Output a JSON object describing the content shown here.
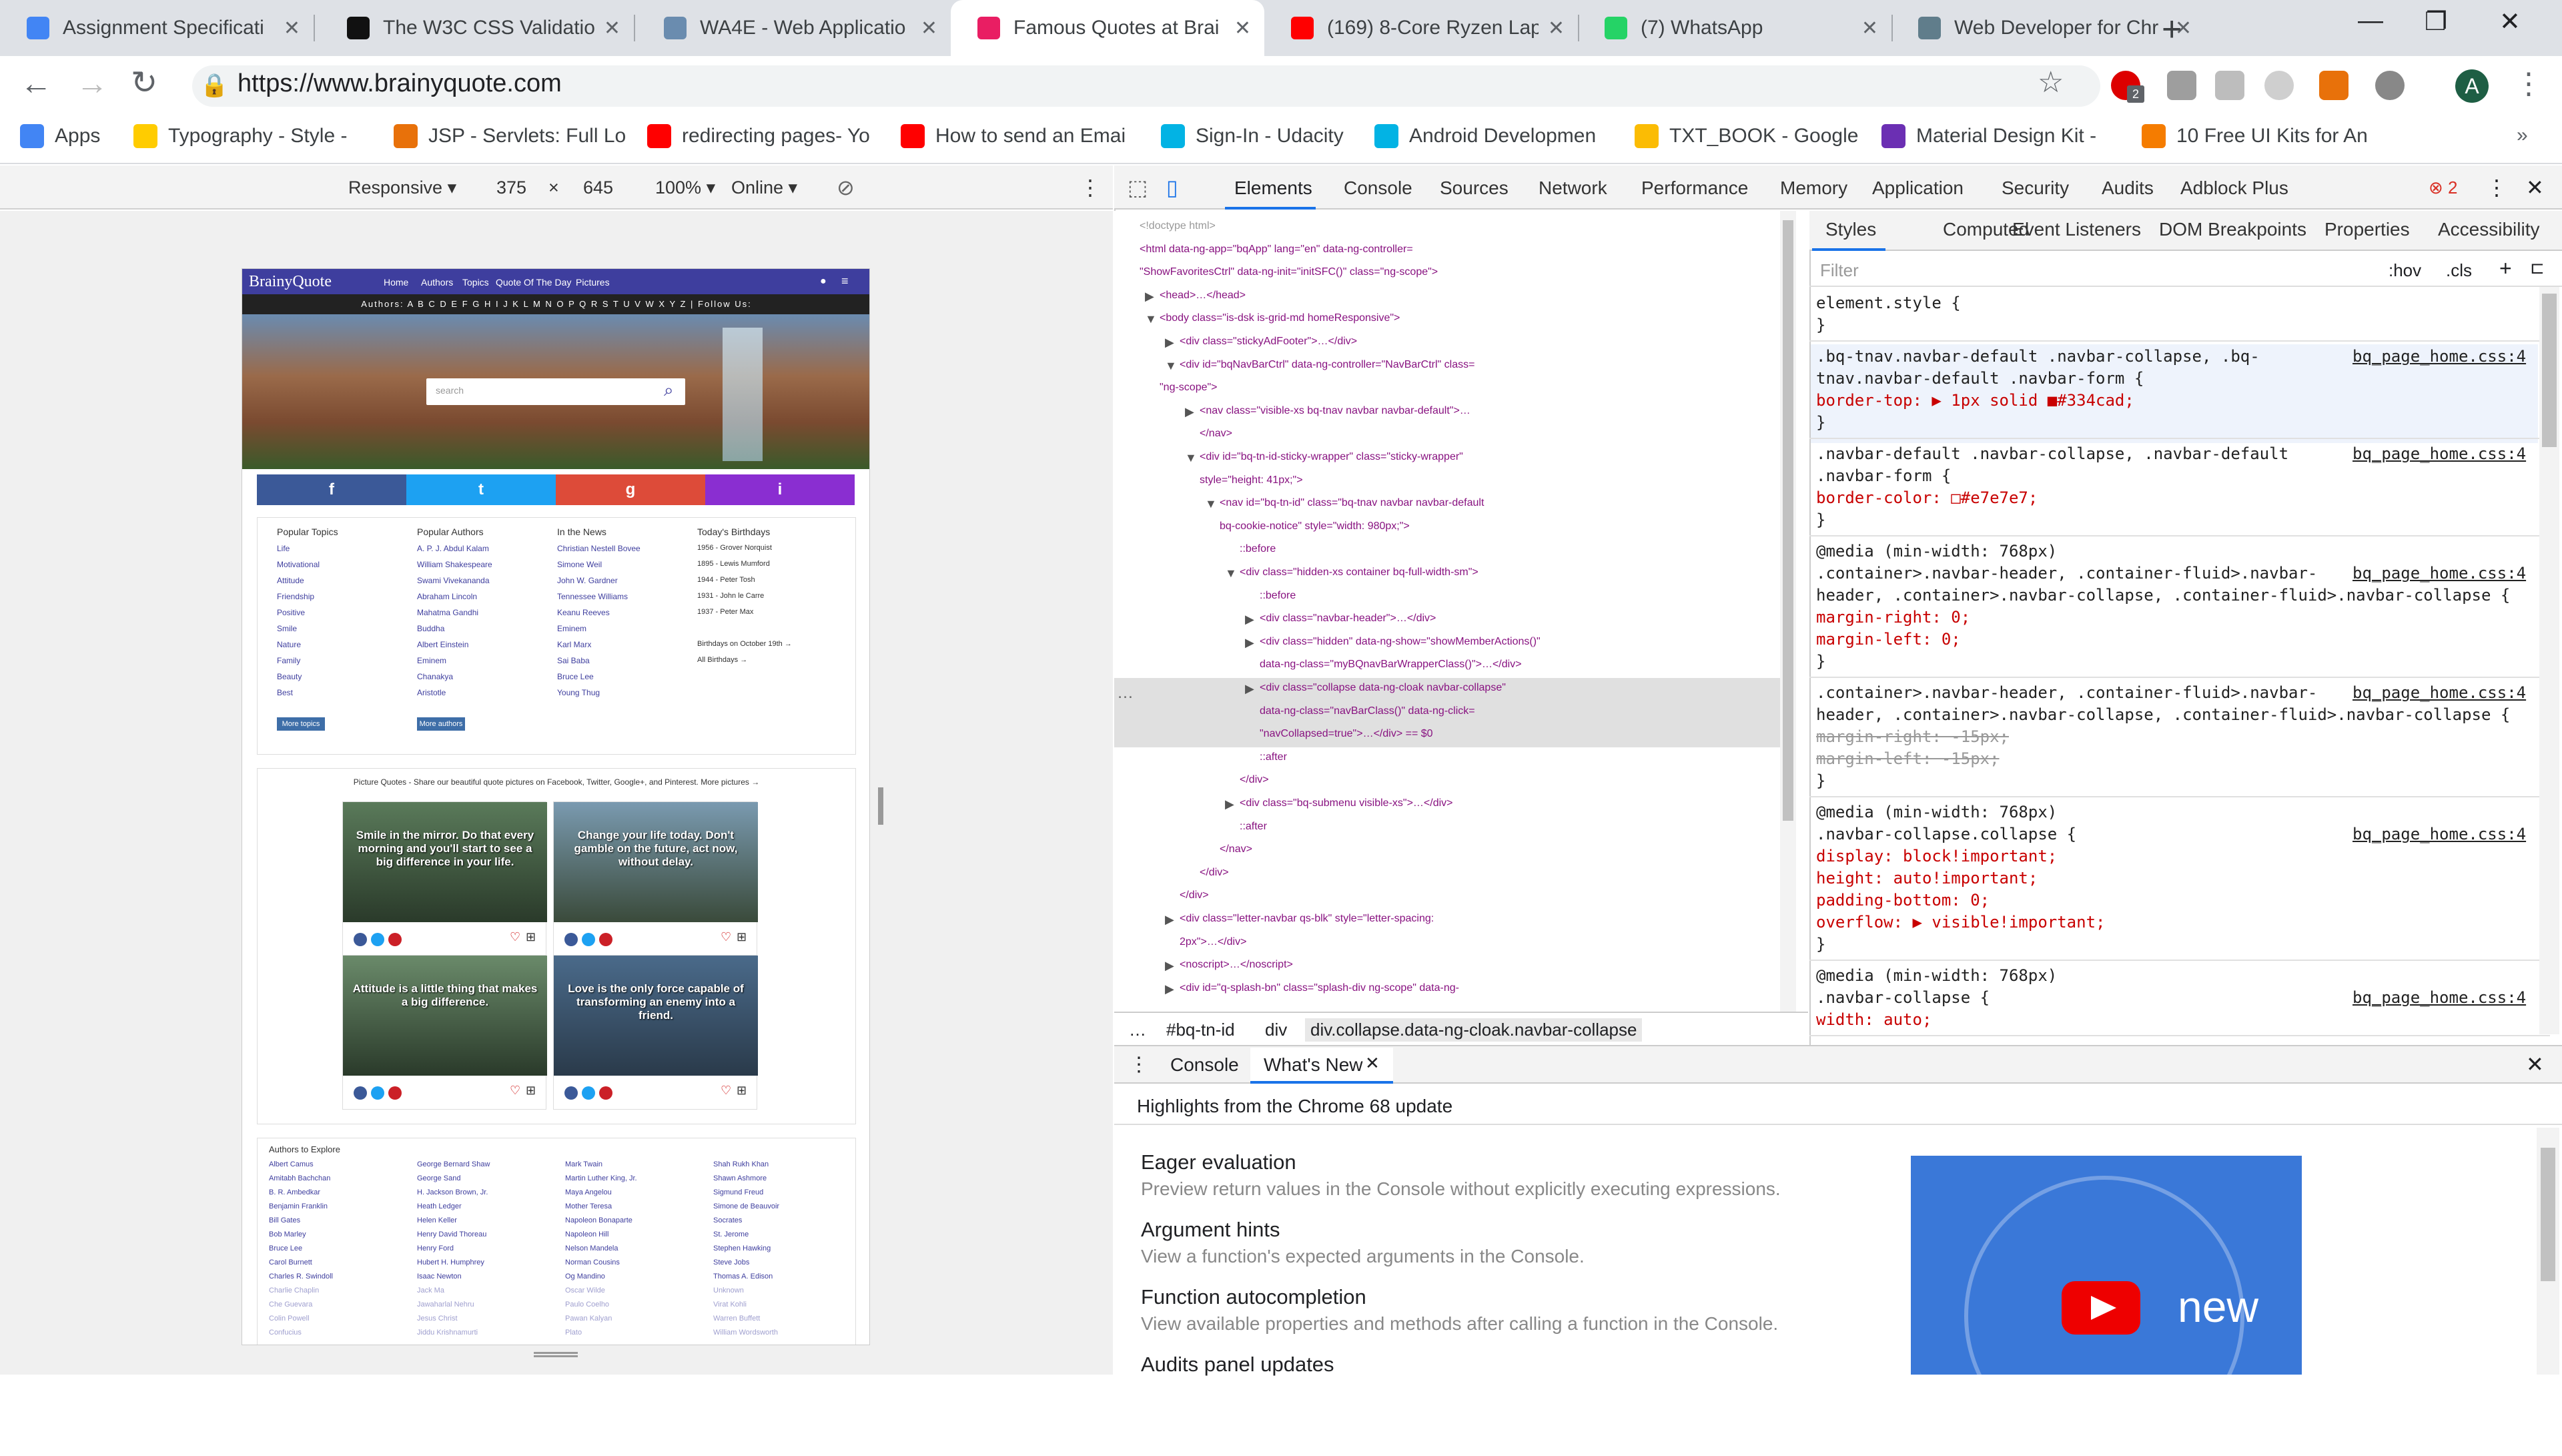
{
  "browser": {
    "tabs": [
      {
        "title": "Assignment Specificati",
        "icon_color": "#4285f4"
      },
      {
        "title": "The W3C CSS Validatio",
        "icon_color": "#111111"
      },
      {
        "title": "WA4E - Web Applicatio",
        "icon_color": "#6a8caf"
      },
      {
        "title": "Famous Quotes at Brai",
        "icon_color": "#e91e63"
      },
      {
        "title": "(169) 8-Core Ryzen Lap",
        "icon_color": "#ff0000"
      },
      {
        "title": "(7) WhatsApp",
        "icon_color": "#25d366"
      },
      {
        "title": "Web Developer for Chr",
        "icon_color": "#607d8b"
      }
    ],
    "url": "https://www.brainyquote.com",
    "avatar": "A",
    "ext_badge": "2",
    "bookmarks": [
      {
        "label": "Apps",
        "icon_color": "#4285f4"
      },
      {
        "label": "Typography - Style -",
        "icon_color": "#ffcc00"
      },
      {
        "label": "JSP - Servlets: Full Lo",
        "icon_color": "#e8710a"
      },
      {
        "label": "redirecting pages- Yo",
        "icon_color": "#ff0000"
      },
      {
        "label": "How to send an Emai",
        "icon_color": "#ff0000"
      },
      {
        "label": "Sign-In - Udacity",
        "icon_color": "#02b3e4"
      },
      {
        "label": "Android Developmen",
        "icon_color": "#02b3e4"
      },
      {
        "label": "TXT_BOOK - Google",
        "icon_color": "#fbbc04"
      },
      {
        "label": "Material Design Kit -",
        "icon_color": "#6b2fb3"
      },
      {
        "label": "10 Free UI Kits for An",
        "icon_color": "#f57c00"
      }
    ]
  },
  "device": {
    "mode": "Responsive",
    "width": "375",
    "x": "×",
    "height": "645",
    "zoom": "100%",
    "network": "Online"
  },
  "site": {
    "logo": "BrainyQuote",
    "nav": [
      "Home",
      "Authors",
      "Topics",
      "Quote Of The Day",
      "Pictures"
    ],
    "authors_bar": "Authors: A B C D E F G H I J K L M N O P Q R S T U V W X Y Z  |  Follow Us:",
    "search_placeholder": "search",
    "social": [
      "f",
      "t",
      "g",
      "i"
    ],
    "columns": [
      {
        "heading": "Popular Topics",
        "items": [
          "Life",
          "Motivational",
          "Attitude",
          "Friendship",
          "Positive",
          "Smile",
          "Nature",
          "Family",
          "Beauty",
          "Best"
        ],
        "button": "More topics"
      },
      {
        "heading": "Popular Authors",
        "items": [
          "A. P. J. Abdul Kalam",
          "William Shakespeare",
          "Swami Vivekananda",
          "Abraham Lincoln",
          "Mahatma Gandhi",
          "Buddha",
          "Albert Einstein",
          "Eminem",
          "Chanakya",
          "Aristotle"
        ],
        "button": "More authors"
      },
      {
        "heading": "In the News",
        "items": [
          "Christian Nestell Bovee",
          "Simone Weil",
          "John W. Gardner",
          "Tennessee Williams",
          "Keanu Reeves",
          "Eminem",
          "Karl Marx",
          "Sai Baba",
          "Bruce Lee",
          "Young Thug"
        ],
        "button": ""
      },
      {
        "heading": "Today's Birthdays",
        "items": [
          "1956 - Grover Norquist",
          "1895 - Lewis Mumford",
          "1944 - Peter Tosh",
          "1931 - John le Carre",
          "1937 - Peter Max",
          "",
          "Birthdays on October 19th →",
          "All Birthdays →"
        ],
        "button": ""
      }
    ],
    "picture_intro": "Picture Quotes - Share our beautiful quote pictures on Facebook, Twitter, Google+, and Pinterest. More pictures →",
    "pictures": [
      {
        "text": "Smile in the mirror. Do that every morning and you'll start to see a big difference in your life."
      },
      {
        "text": "Change your life today. Don't gamble on the future, act now, without delay."
      },
      {
        "text": "Attitude is a little thing that makes a big difference."
      },
      {
        "text": "Love is the only force capable of transforming an enemy into a friend."
      }
    ],
    "explore_heading": "Authors to Explore",
    "explore": [
      [
        "Albert Camus",
        "Amitabh Bachchan",
        "B. R. Ambedkar",
        "Benjamin Franklin",
        "Bill Gates",
        "Bob Marley",
        "Bruce Lee",
        "Carol Burnett",
        "Charles R. Swindoll",
        "Charlie Chaplin",
        "Che Guevara",
        "Colin Powell",
        "Confucius"
      ],
      [
        "George Bernard Shaw",
        "George Sand",
        "H. Jackson Brown, Jr.",
        "Heath Ledger",
        "Helen Keller",
        "Henry David Thoreau",
        "Henry Ford",
        "Hubert H. Humphrey",
        "Isaac Newton",
        "Jack Ma",
        "Jawaharlal Nehru",
        "Jesus Christ",
        "Jiddu Krishnamurti"
      ],
      [
        "Mark Twain",
        "Martin Luther King, Jr.",
        "Maya Angelou",
        "Mother Teresa",
        "Napoleon Bonaparte",
        "Napoleon Hill",
        "Nelson Mandela",
        "Norman Cousins",
        "Og Mandino",
        "Oscar Wilde",
        "Paulo Coelho",
        "Pawan Kalyan",
        "Plato"
      ],
      [
        "Shah Rukh Khan",
        "Shawn Ashmore",
        "Sigmund Freud",
        "Simone de Beauvoir",
        "Socrates",
        "St. Jerome",
        "Stephen Hawking",
        "Steve Jobs",
        "Thomas A. Edison",
        "Unknown",
        "Virat Kohli",
        "Warren Buffett",
        "William Wordsworth"
      ]
    ]
  },
  "devtools": {
    "tabs": [
      "Elements",
      "Console",
      "Sources",
      "Network",
      "Performance",
      "Memory",
      "Application",
      "Security",
      "Audits",
      "Adblock Plus"
    ],
    "error_count": "2",
    "elements": [
      {
        "indent": 0,
        "arrow": "",
        "html": "<!doctype html>"
      },
      {
        "indent": 0,
        "arrow": "",
        "html": "<html data-ng-app=\"bqApp\" lang=\"en\" data-ng-controller="
      },
      {
        "indent": 0,
        "arrow": "",
        "html": "\"ShowFavoritesCtrl\" data-ng-init=\"initSFC()\" class=\"ng-scope\">"
      },
      {
        "indent": 1,
        "arrow": "▶",
        "html": "<head>…</head>"
      },
      {
        "indent": 1,
        "arrow": "▼",
        "html": "<body class=\"is-dsk is-grid-md homeResponsive\">"
      },
      {
        "indent": 2,
        "arrow": "▶",
        "html": "<div class=\"stickyAdFooter\">…</div>"
      },
      {
        "indent": 2,
        "arrow": "▼",
        "html": "<div id=\"bqNavBarCtrl\" data-ng-controller=\"NavBarCtrl\" class="
      },
      {
        "indent": 1,
        "arrow": "",
        "html": "\"ng-scope\">"
      },
      {
        "indent": 3,
        "arrow": "▶",
        "html": "<nav class=\"visible-xs bq-tnav navbar navbar-default\">…"
      },
      {
        "indent": 3,
        "arrow": "",
        "html": "</nav>"
      },
      {
        "indent": 3,
        "arrow": "▼",
        "html": "<div id=\"bq-tn-id-sticky-wrapper\" class=\"sticky-wrapper\""
      },
      {
        "indent": 3,
        "arrow": "",
        "html": "style=\"height: 41px;\">"
      },
      {
        "indent": 4,
        "arrow": "▼",
        "html": "<nav id=\"bq-tn-id\" class=\"bq-tnav navbar navbar-default"
      },
      {
        "indent": 4,
        "arrow": "",
        "html": "bq-cookie-notice\" style=\"width: 980px;\">"
      },
      {
        "indent": 5,
        "arrow": "",
        "html": "::before"
      },
      {
        "indent": 5,
        "arrow": "▼",
        "html": "<div class=\"hidden-xs container bq-full-width-sm\">"
      },
      {
        "indent": 6,
        "arrow": "",
        "html": "::before"
      },
      {
        "indent": 6,
        "arrow": "▶",
        "html": "<div class=\"navbar-header\">…</div>"
      },
      {
        "indent": 6,
        "arrow": "▶",
        "html": "<div class=\"hidden\" data-ng-show=\"showMemberActions()\""
      },
      {
        "indent": 6,
        "arrow": "",
        "html": "data-ng-class=\"myBQnavBarWrapperClass()\">…</div>"
      },
      {
        "indent": 6,
        "arrow": "▶",
        "html": "<div class=\"collapse data-ng-cloak navbar-collapse\""
      },
      {
        "indent": 6,
        "arrow": "",
        "html": "data-ng-class=\"navBarClass()\" data-ng-click="
      },
      {
        "indent": 6,
        "arrow": "",
        "html": "\"navCollapsed=true\">…</div> == $0"
      },
      {
        "indent": 6,
        "arrow": "",
        "html": "::after"
      },
      {
        "indent": 5,
        "arrow": "",
        "html": "</div>"
      },
      {
        "indent": 5,
        "arrow": "▶",
        "html": "<div class=\"bq-submenu visible-xs\">…</div>"
      },
      {
        "indent": 5,
        "arrow": "",
        "html": "::after"
      },
      {
        "indent": 4,
        "arrow": "",
        "html": "</nav>"
      },
      {
        "indent": 3,
        "arrow": "",
        "html": "</div>"
      },
      {
        "indent": 2,
        "arrow": "",
        "html": "</div>"
      },
      {
        "indent": 2,
        "arrow": "▶",
        "html": "<div class=\"letter-navbar qs-blk\" style=\"letter-spacing:"
      },
      {
        "indent": 2,
        "arrow": "",
        "html": "2px\">…</div>"
      },
      {
        "indent": 2,
        "arrow": "▶",
        "html": "<noscript>…</noscript>"
      },
      {
        "indent": 2,
        "arrow": "▶",
        "html": "<div id=\"q-splash-bn\" class=\"splash-div ng-scope\" data-ng-"
      }
    ],
    "breadcrumbs": [
      "…",
      "#bq-tn-id",
      "div",
      "div.collapse.data-ng-cloak.navbar-collapse"
    ],
    "styles_tabs": [
      "Styles",
      "Computed",
      "Event Listeners",
      "DOM Breakpoints",
      "Properties",
      "Accessibility"
    ],
    "filter_placeholder": "Filter",
    "hov": ":hov",
    "cls": ".cls",
    "styles": [
      {
        "lines": [
          "element.style {",
          "}"
        ],
        "src": ""
      },
      {
        "lines": [
          ".bq-tnav.navbar-default .navbar-collapse, .bq-",
          "tnav.navbar-default .navbar-form {",
          "  border-top: ▶ 1px solid ■#334cad;",
          "}"
        ],
        "src": "bq_page_home.css:4"
      },
      {
        "lines": [
          ".navbar-default .navbar-collapse, .navbar-default",
          ".navbar-form {",
          "  border-color: □#e7e7e7;",
          "}"
        ],
        "src": "bq_page_home.css:4"
      },
      {
        "lines": [
          "@media (min-width: 768px)",
          ".container>.navbar-header, .container-fluid>.navbar-",
          "header, .container>.navbar-collapse, .container-fluid>.navbar-collapse {",
          "  margin-right: 0;",
          "  margin-left: 0;",
          "}"
        ],
        "src": "bq_page_home.css:4"
      },
      {
        "lines": [
          ".container>.navbar-header, .container-fluid>.navbar-",
          "header, .container>.navbar-collapse, .container-fluid>.navbar-collapse {",
          "  margin-right: -15px;",
          "  margin-left: -15px;",
          "}"
        ],
        "src": "bq_page_home.css:4"
      },
      {
        "lines": [
          "@media (min-width: 768px)",
          ".navbar-collapse.collapse {",
          "  display: block!important;",
          "  height: auto!important;",
          "  padding-bottom: 0;",
          "  overflow: ▶ visible!important;",
          "}"
        ],
        "src": "bq_page_home.css:4"
      },
      {
        "lines": [
          "@media (min-width: 768px)",
          ".navbar-collapse {",
          "  width: auto;"
        ],
        "src": "bq_page_home.css:4"
      }
    ],
    "drawer_tabs": [
      "Console",
      "What's New"
    ],
    "highlights": "Highlights from the Chrome 68 update",
    "whatsnew": [
      {
        "title": "Eager evaluation",
        "desc": "Preview return values in the Console without explicitly executing expressions."
      },
      {
        "title": "Argument hints",
        "desc": "View a function's expected arguments in the Console."
      },
      {
        "title": "Function autocompletion",
        "desc": "View available properties and methods after calling a function in the Console."
      },
      {
        "title": "Audits panel updates",
        "desc": ""
      }
    ],
    "video_text": "new"
  }
}
